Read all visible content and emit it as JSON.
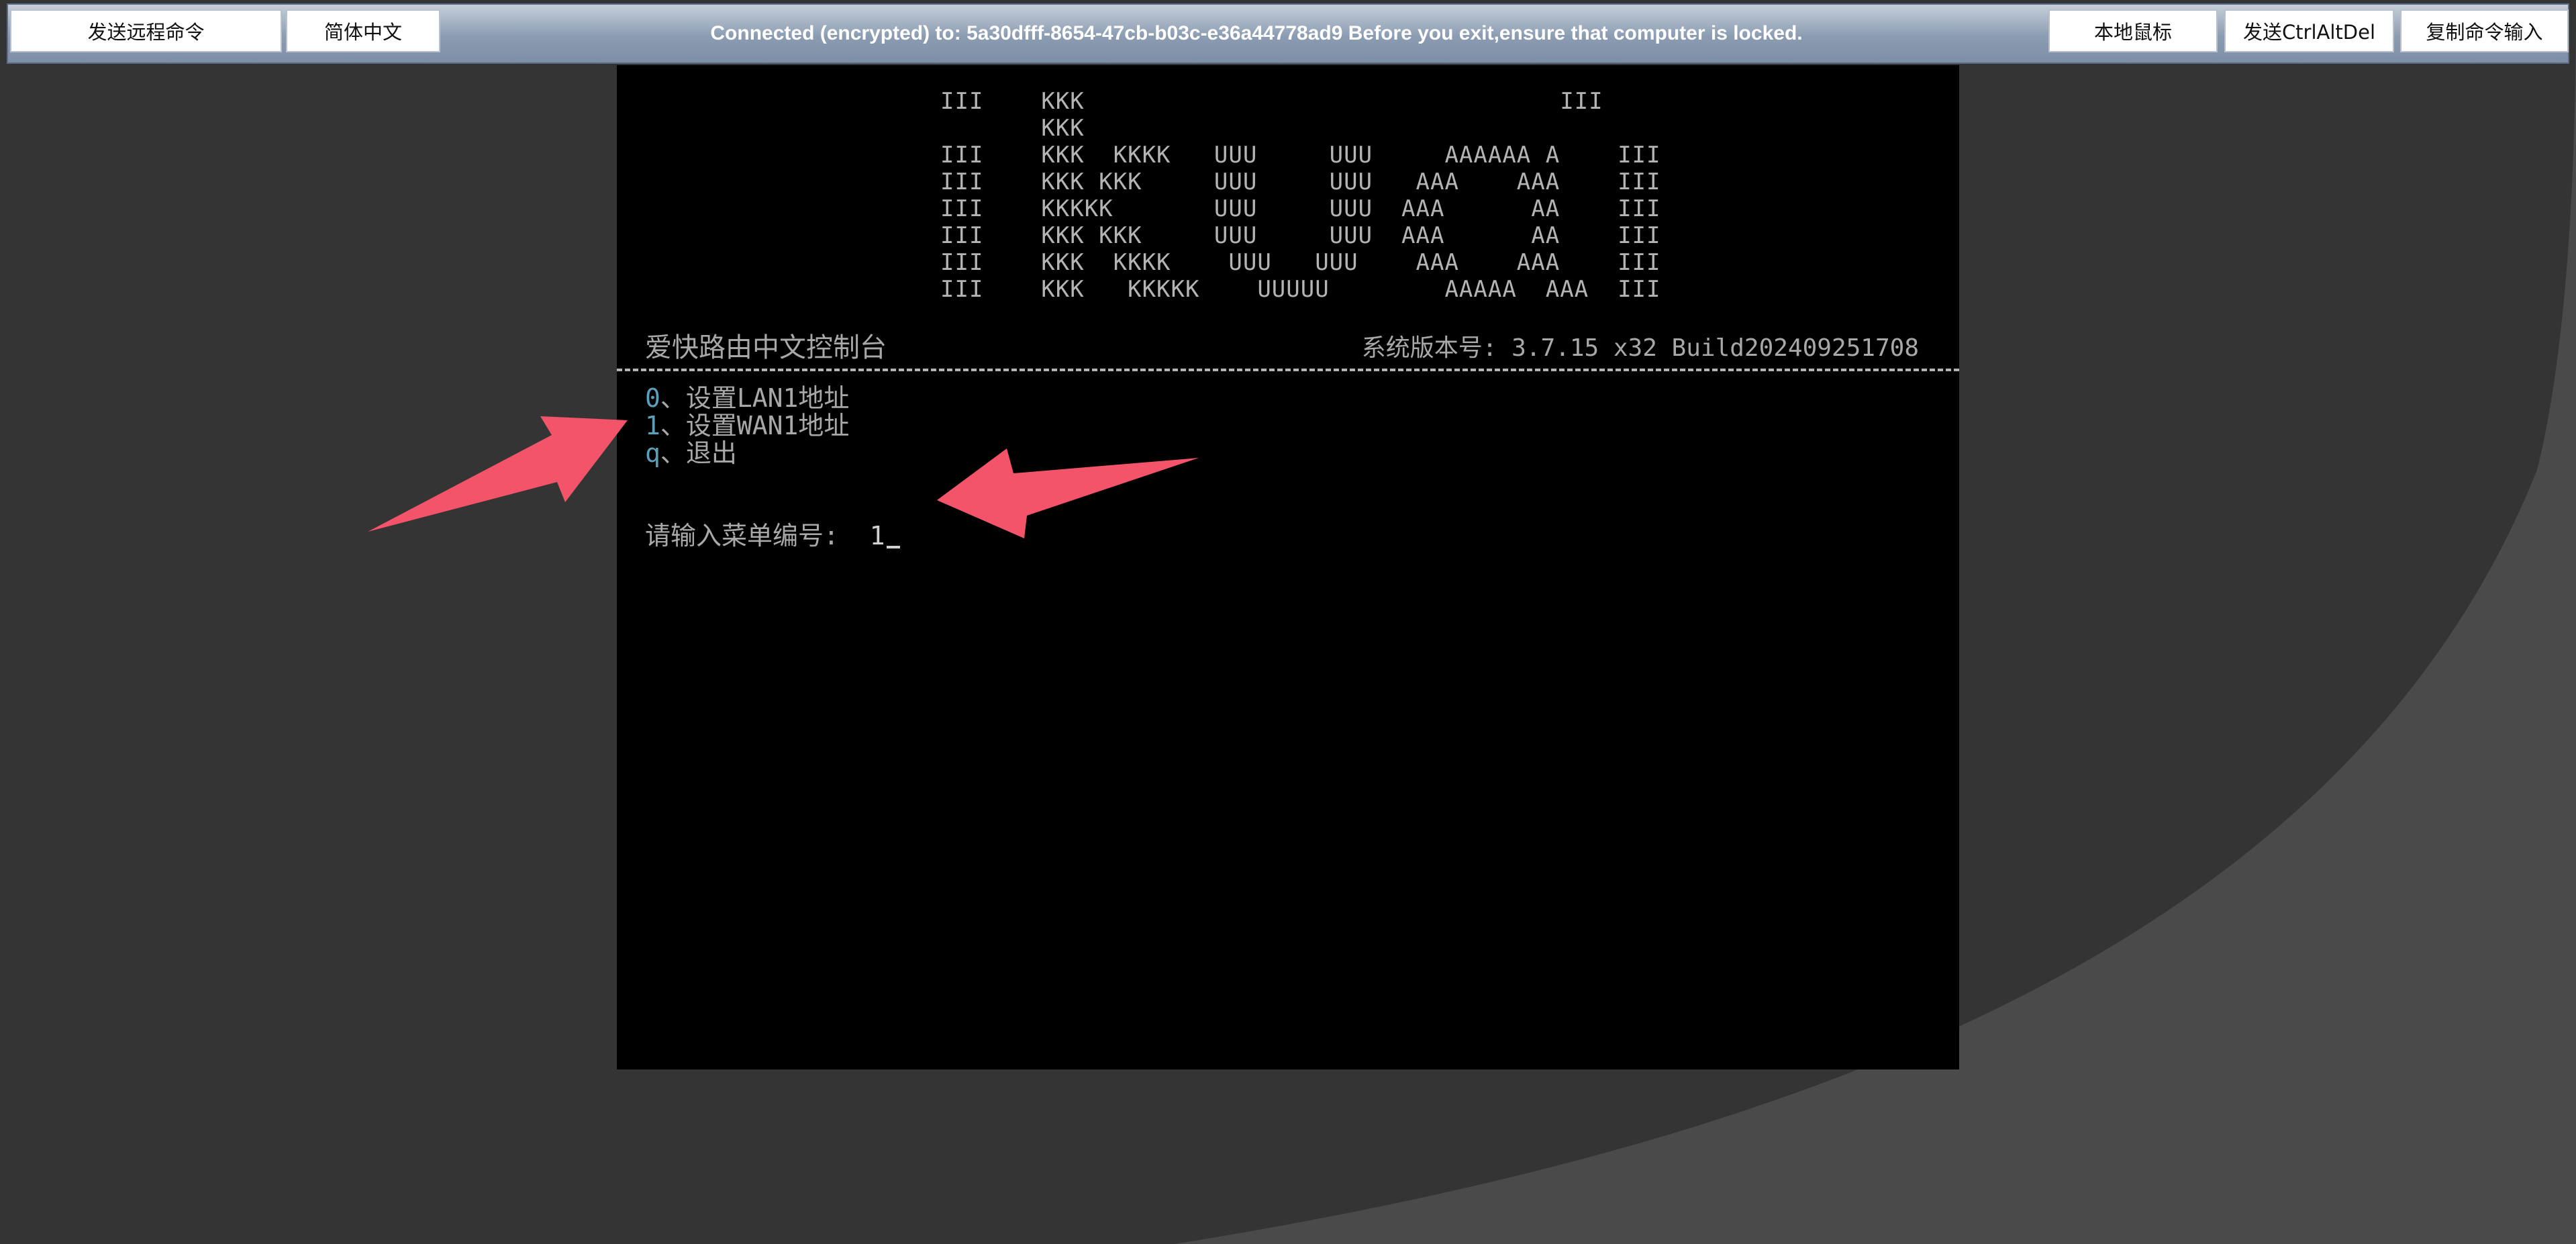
{
  "toolbar": {
    "send_remote_command": "发送远程命令",
    "simplified_chinese": "简体中文",
    "status": "Connected (encrypted) to: 5a30dfff-8654-47cb-b03c-e36a44778ad9 Before you exit,ensure that computer is locked.",
    "local_mouse": "本地鼠标",
    "send_ctrl_alt_del": "发送CtrlAltDel",
    "copy_command_input": "复制命令输入"
  },
  "console": {
    "ascii_art": [
      "III    KKK                                 III",
      "       KKK",
      "III    KKK  KKKK   UUU     UUU     AAAAAA A    III",
      "III    KKK KKK     UUU     UUU   AAA    AAA    III",
      "III    KKKKK       UUU     UUU  AAA      AA    III",
      "III    KKK KKK     UUU     UUU  AAA      AA    III",
      "III    KKK  KKKK    UUU   UUU    AAA    AAA    III",
      "III    KKK   KKKKK    UUUUU        AAAAA  AAA  III"
    ],
    "title": "爱快路由中文控制台",
    "version_label": "系统版本号: 3.7.15 x32 Build202409251708",
    "menu": [
      {
        "key": "0",
        "sep": "、",
        "label": "设置LAN1地址"
      },
      {
        "key": "1",
        "sep": "、",
        "label": "设置WAN1地址"
      },
      {
        "key": "q",
        "sep": "、",
        "label": "退出"
      }
    ],
    "prompt_label": "请输入菜单编号:  ",
    "prompt_value": "1"
  },
  "colors": {
    "toolbar_gradient_top": "#c6cfda",
    "toolbar_gradient_bottom": "#7d8ea6",
    "console_bg": "#000000",
    "menu_key": "#5aa0b8",
    "annotation_arrow": "#f4546a",
    "page_bg_dark": "#343434",
    "page_bg_light": "#4a4a4a"
  },
  "icons": {
    "annotation_arrow_left": "arrow-pointing-to-menu-item-1",
    "annotation_arrow_prompt": "arrow-pointing-to-prompt-input"
  }
}
